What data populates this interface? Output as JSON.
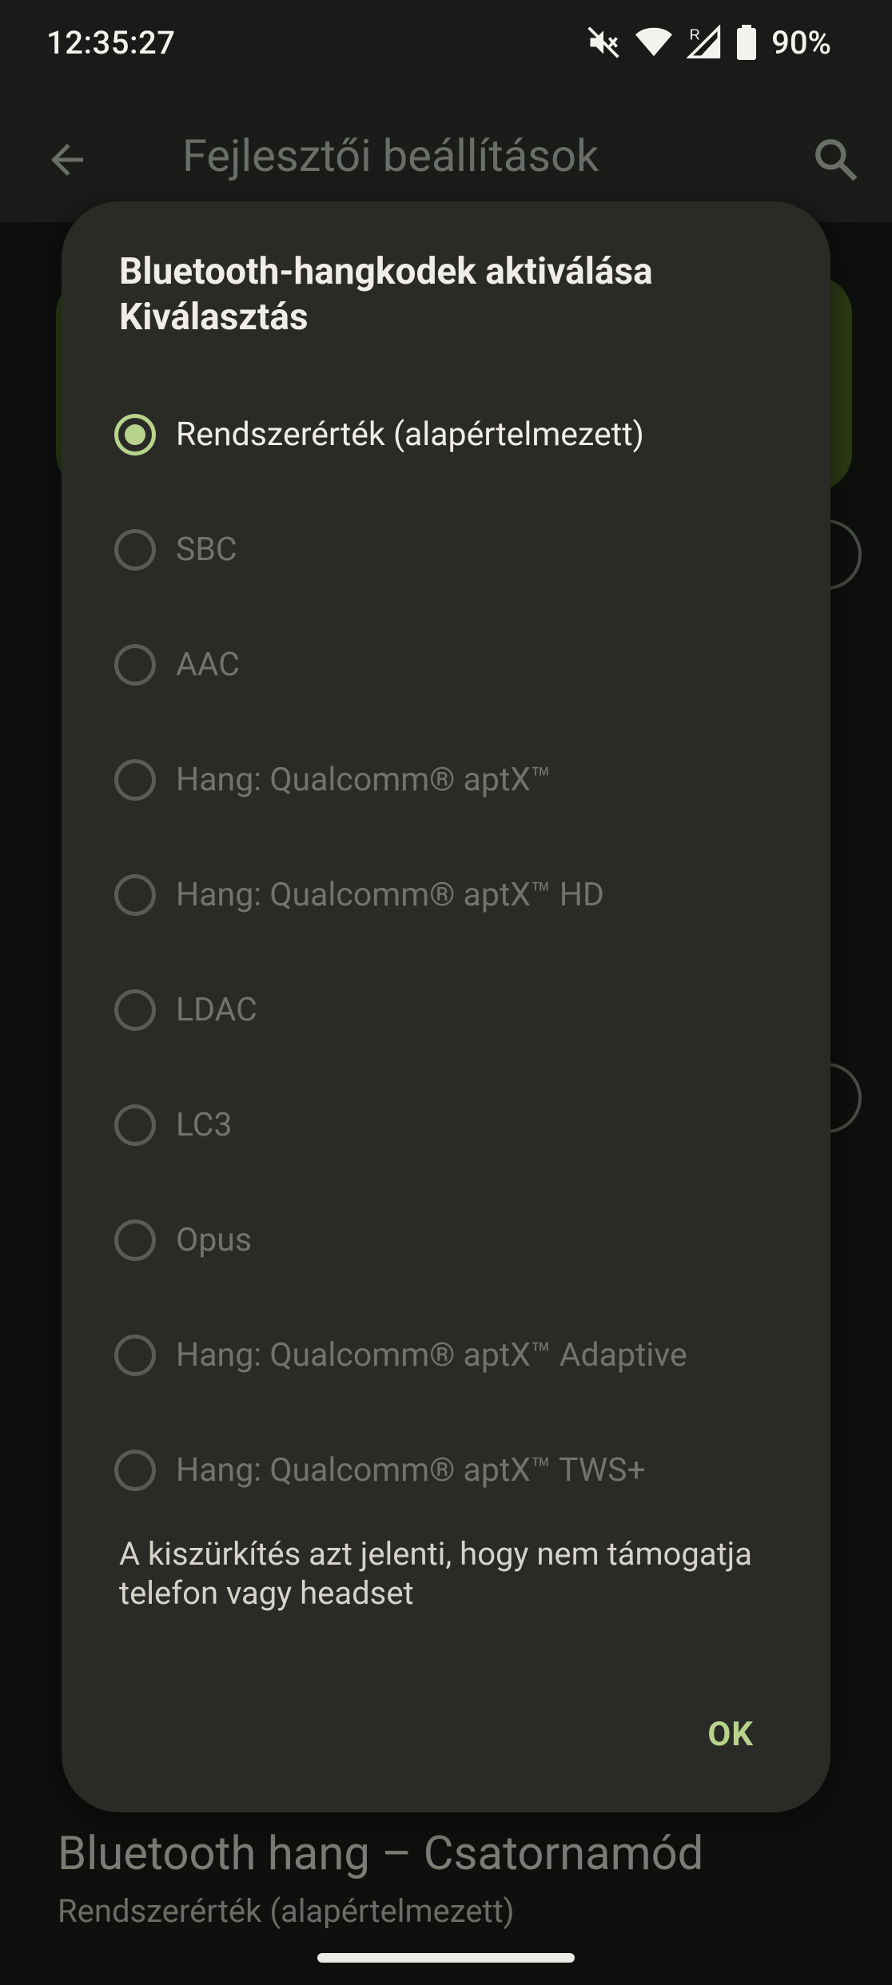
{
  "status_bar": {
    "time": "12:35:27",
    "battery": "90%",
    "icons": [
      "mute-icon",
      "wifi-icon",
      "signal-roaming-icon",
      "battery-icon"
    ]
  },
  "app_bar": {
    "title": "Fejlesztői beállítások",
    "back_icon": "arrow-back-icon",
    "search_icon": "search-icon"
  },
  "background": {
    "pref_title": "Bluetooth hang – Csatornamód",
    "pref_subtitle": "Rendszerérték (alapértelmezett)"
  },
  "dialog": {
    "title": "Bluetooth-hangkodek aktiválása Kiválasztás",
    "options": [
      {
        "label": "Rendszerérték (alapértelmezett)",
        "selected": true,
        "enabled": true
      },
      {
        "label": "SBC",
        "selected": false,
        "enabled": false
      },
      {
        "label": "AAC",
        "selected": false,
        "enabled": false
      },
      {
        "label": "Hang: Qualcomm® aptX™",
        "selected": false,
        "enabled": false
      },
      {
        "label": "Hang: Qualcomm® aptX™ HD",
        "selected": false,
        "enabled": false
      },
      {
        "label": "LDAC",
        "selected": false,
        "enabled": false
      },
      {
        "label": "LC3",
        "selected": false,
        "enabled": false
      },
      {
        "label": "Opus",
        "selected": false,
        "enabled": false
      },
      {
        "label": "Hang: Qualcomm® aptX™ Adaptive",
        "selected": false,
        "enabled": false
      },
      {
        "label": "Hang: Qualcomm® aptX™ TWS+",
        "selected": false,
        "enabled": false
      }
    ],
    "note": "A kiszürkítés azt jelenti, hogy nem támogatja telefon vagy headset",
    "ok_label": "OK"
  },
  "colors": {
    "accent": "#b7d38c",
    "dialog_bg": "#2a2b27",
    "disabled_text": "#72736e"
  }
}
